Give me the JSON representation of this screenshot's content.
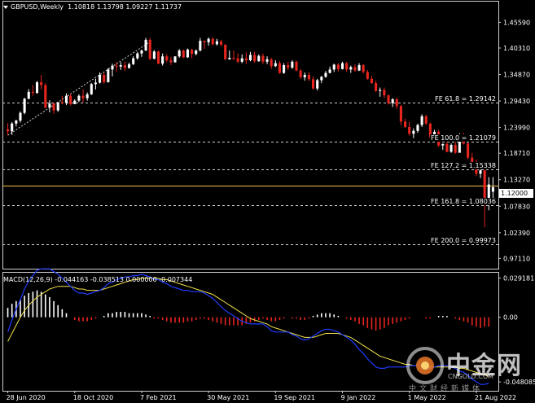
{
  "window": {
    "header": {
      "symbol": "GBPUSD,Weekly",
      "ohlc": "1.10818 1.13798 1.09227 1.11737"
    },
    "macd_header": "MACD(12,26,9) -0.044163 -0.038513 0.000000 -0.007344",
    "current_price": "1.12000",
    "colors": {
      "bull": "#ffffff",
      "bear": "#e8251e",
      "macd_signal": "#f2e24b",
      "macd_main": "#1f3cff",
      "current_line": "#f5c542",
      "grid": "#cfcfcf"
    }
  },
  "chart_data": [
    {
      "type": "candlestick",
      "title": "GBPUSD,Weekly",
      "ylim": [
        0.95,
        1.475
      ],
      "y_ticks": [
        "1.45590",
        "1.40310",
        "1.34870",
        "1.29430",
        "1.23990",
        "1.18710",
        "1.13270",
        "1.07830",
        "1.02390",
        "0.97110"
      ],
      "y_tick_values": [
        1.4559,
        1.4031,
        1.3487,
        1.2943,
        1.2399,
        1.1871,
        1.1327,
        1.0783,
        1.0239,
        0.9711
      ],
      "x_ticks": [
        "28 Jun 2020",
        "18 Oct 2020",
        "7 Feb 2021",
        "30 May 2021",
        "19 Sep 2021",
        "9 Jan 2022",
        "1 May 2022",
        "21 Aug 2022"
      ],
      "x_tick_index": [
        0,
        16,
        32,
        48,
        64,
        80,
        96,
        112
      ],
      "fib_levels": [
        {
          "label": "FE 61.8 = 1.29142",
          "value": 1.29142
        },
        {
          "label": "FE 100.0 = 1.21079",
          "value": 1.21079
        },
        {
          "label": "FE 127.2 = 1.15338",
          "value": 1.15338
        },
        {
          "label": "FE 161.8 = 1.08036",
          "value": 1.08036
        },
        {
          "label": "FE 200.0 = 0.99973",
          "value": 0.99973
        }
      ],
      "current_price": 1.12,
      "candles": [
        [
          1.236,
          1.249,
          1.224,
          1.232
        ],
        [
          1.232,
          1.251,
          1.225,
          1.248
        ],
        [
          1.248,
          1.256,
          1.242,
          1.254
        ],
        [
          1.254,
          1.273,
          1.25,
          1.27
        ],
        [
          1.27,
          1.301,
          1.267,
          1.299
        ],
        [
          1.299,
          1.319,
          1.298,
          1.313
        ],
        [
          1.313,
          1.327,
          1.305,
          1.311
        ],
        [
          1.311,
          1.335,
          1.309,
          1.333
        ],
        [
          1.333,
          1.348,
          1.318,
          1.327
        ],
        [
          1.327,
          1.331,
          1.279,
          1.281
        ],
        [
          1.281,
          1.296,
          1.271,
          1.289
        ],
        [
          1.289,
          1.291,
          1.268,
          1.275
        ],
        [
          1.275,
          1.292,
          1.272,
          1.292
        ],
        [
          1.292,
          1.305,
          1.288,
          1.29
        ],
        [
          1.29,
          1.31,
          1.286,
          1.305
        ],
        [
          1.305,
          1.309,
          1.285,
          1.288
        ],
        [
          1.288,
          1.298,
          1.288,
          1.295
        ],
        [
          1.295,
          1.308,
          1.292,
          1.305
        ],
        [
          1.305,
          1.318,
          1.291,
          1.3
        ],
        [
          1.3,
          1.312,
          1.295,
          1.308
        ],
        [
          1.308,
          1.331,
          1.307,
          1.329
        ],
        [
          1.329,
          1.34,
          1.318,
          1.332
        ],
        [
          1.332,
          1.353,
          1.33,
          1.348
        ],
        [
          1.348,
          1.353,
          1.33,
          1.333
        ],
        [
          1.333,
          1.362,
          1.332,
          1.359
        ],
        [
          1.359,
          1.371,
          1.345,
          1.367
        ],
        [
          1.367,
          1.374,
          1.354,
          1.365
        ],
        [
          1.365,
          1.374,
          1.358,
          1.368
        ],
        [
          1.368,
          1.375,
          1.356,
          1.362
        ],
        [
          1.362,
          1.373,
          1.361,
          1.37
        ],
        [
          1.37,
          1.386,
          1.368,
          1.382
        ],
        [
          1.382,
          1.395,
          1.379,
          1.392
        ],
        [
          1.392,
          1.4,
          1.385,
          1.398
        ],
        [
          1.398,
          1.424,
          1.397,
          1.42
        ],
        [
          1.42,
          1.424,
          1.378,
          1.381
        ],
        [
          1.381,
          1.399,
          1.38,
          1.396
        ],
        [
          1.396,
          1.398,
          1.37,
          1.371
        ],
        [
          1.371,
          1.392,
          1.367,
          1.386
        ],
        [
          1.386,
          1.39,
          1.374,
          1.378
        ],
        [
          1.378,
          1.385,
          1.368,
          1.374
        ],
        [
          1.374,
          1.386,
          1.373,
          1.386
        ],
        [
          1.386,
          1.401,
          1.383,
          1.398
        ],
        [
          1.398,
          1.4,
          1.382,
          1.384
        ],
        [
          1.384,
          1.402,
          1.383,
          1.4
        ],
        [
          1.4,
          1.401,
          1.382,
          1.391
        ],
        [
          1.391,
          1.4,
          1.388,
          1.398
        ],
        [
          1.398,
          1.424,
          1.396,
          1.418
        ],
        [
          1.418,
          1.418,
          1.401,
          1.415
        ],
        [
          1.415,
          1.425,
          1.408,
          1.422
        ],
        [
          1.422,
          1.425,
          1.409,
          1.411
        ],
        [
          1.411,
          1.422,
          1.408,
          1.417
        ],
        [
          1.417,
          1.42,
          1.407,
          1.41
        ],
        [
          1.41,
          1.411,
          1.379,
          1.38
        ],
        [
          1.38,
          1.398,
          1.379,
          1.383
        ],
        [
          1.383,
          1.398,
          1.378,
          1.382
        ],
        [
          1.382,
          1.392,
          1.372,
          1.375
        ],
        [
          1.375,
          1.39,
          1.372,
          1.382
        ],
        [
          1.382,
          1.394,
          1.37,
          1.378
        ],
        [
          1.378,
          1.395,
          1.376,
          1.389
        ],
        [
          1.389,
          1.396,
          1.373,
          1.376
        ],
        [
          1.376,
          1.39,
          1.375,
          1.387
        ],
        [
          1.387,
          1.392,
          1.37,
          1.375
        ],
        [
          1.375,
          1.386,
          1.37,
          1.38
        ],
        [
          1.38,
          1.383,
          1.36,
          1.366
        ],
        [
          1.366,
          1.378,
          1.364,
          1.372
        ],
        [
          1.372,
          1.376,
          1.35,
          1.352
        ],
        [
          1.352,
          1.372,
          1.35,
          1.368
        ],
        [
          1.368,
          1.375,
          1.358,
          1.363
        ],
        [
          1.363,
          1.378,
          1.36,
          1.375
        ],
        [
          1.375,
          1.377,
          1.355,
          1.357
        ],
        [
          1.357,
          1.36,
          1.34,
          1.343
        ],
        [
          1.343,
          1.353,
          1.336,
          1.348
        ],
        [
          1.348,
          1.354,
          1.335,
          1.339
        ],
        [
          1.339,
          1.345,
          1.318,
          1.32
        ],
        [
          1.32,
          1.34,
          1.316,
          1.337
        ],
        [
          1.337,
          1.346,
          1.331,
          1.344
        ],
        [
          1.344,
          1.356,
          1.342,
          1.352
        ],
        [
          1.352,
          1.365,
          1.351,
          1.359
        ],
        [
          1.359,
          1.371,
          1.354,
          1.369
        ],
        [
          1.369,
          1.372,
          1.355,
          1.36
        ],
        [
          1.36,
          1.375,
          1.359,
          1.372
        ],
        [
          1.372,
          1.375,
          1.354,
          1.359
        ],
        [
          1.359,
          1.367,
          1.352,
          1.364
        ],
        [
          1.364,
          1.37,
          1.354,
          1.357
        ],
        [
          1.357,
          1.372,
          1.356,
          1.368
        ],
        [
          1.368,
          1.37,
          1.351,
          1.354
        ],
        [
          1.354,
          1.358,
          1.338,
          1.34
        ],
        [
          1.34,
          1.346,
          1.33,
          1.331
        ],
        [
          1.331,
          1.336,
          1.313,
          1.315
        ],
        [
          1.315,
          1.322,
          1.303,
          1.317
        ],
        [
          1.317,
          1.322,
          1.3,
          1.306
        ],
        [
          1.306,
          1.308,
          1.287,
          1.29
        ],
        [
          1.29,
          1.3,
          1.282,
          1.298
        ],
        [
          1.298,
          1.301,
          1.278,
          1.284
        ],
        [
          1.284,
          1.286,
          1.245,
          1.252
        ],
        [
          1.252,
          1.258,
          1.239,
          1.241
        ],
        [
          1.241,
          1.251,
          1.223,
          1.227
        ],
        [
          1.227,
          1.238,
          1.218,
          1.233
        ],
        [
          1.233,
          1.248,
          1.229,
          1.245
        ],
        [
          1.245,
          1.267,
          1.241,
          1.263
        ],
        [
          1.263,
          1.266,
          1.245,
          1.248
        ],
        [
          1.248,
          1.25,
          1.215,
          1.22
        ],
        [
          1.22,
          1.235,
          1.215,
          1.231
        ],
        [
          1.231,
          1.235,
          1.2,
          1.203
        ],
        [
          1.203,
          1.207,
          1.194,
          1.206
        ],
        [
          1.206,
          1.212,
          1.189,
          1.19
        ],
        [
          1.19,
          1.207,
          1.188,
          1.204
        ],
        [
          1.204,
          1.21,
          1.186,
          1.188
        ],
        [
          1.188,
          1.228,
          1.189,
          1.216
        ],
        [
          1.216,
          1.229,
          1.205,
          1.207
        ],
        [
          1.207,
          1.209,
          1.175,
          1.178
        ],
        [
          1.178,
          1.188,
          1.165,
          1.168
        ],
        [
          1.168,
          1.174,
          1.14,
          1.145
        ],
        [
          1.145,
          1.16,
          1.136,
          1.152
        ],
        [
          1.152,
          1.153,
          1.035,
          1.085
        ],
        [
          1.085,
          1.138,
          1.07,
          1.123
        ],
        [
          1.108,
          1.138,
          1.0923,
          1.1174
        ]
      ]
    },
    {
      "type": "histogram+line",
      "title": "MACD(12,26,9) -0.044163 -0.038513 0.000000 -0.007344",
      "ylim": [
        -0.0535,
        0.0325
      ],
      "y_ticks": [
        "0.029181",
        "0.00",
        "-0.048085"
      ],
      "y_tick_values": [
        0.029181,
        0.0,
        -0.048085
      ],
      "histogram": [
        0.007,
        0.01,
        0.012,
        0.013,
        0.016,
        0.018,
        0.019,
        0.02,
        0.019,
        0.017,
        0.015,
        0.012,
        0.009,
        0.006,
        0.003,
        0.0,
        -0.002,
        -0.003,
        -0.003,
        -0.003,
        -0.002,
        -0.001,
        0.0,
        0.001,
        0.003,
        0.003,
        0.004,
        0.004,
        0.004,
        0.003,
        0.003,
        0.003,
        0.003,
        0.002,
        0.001,
        -0.001,
        -0.001,
        -0.002,
        -0.003,
        -0.004,
        -0.004,
        -0.004,
        -0.004,
        -0.003,
        -0.003,
        -0.002,
        -0.001,
        -0.001,
        -0.002,
        -0.003,
        -0.004,
        -0.005,
        -0.006,
        -0.006,
        -0.006,
        -0.006,
        -0.006,
        -0.005,
        -0.004,
        -0.003,
        -0.002,
        -0.001,
        -0.002,
        -0.003,
        -0.003,
        -0.002,
        -0.001,
        0.0,
        -0.001,
        -0.001,
        -0.002,
        -0.002,
        -0.001,
        0.001,
        0.002,
        0.003,
        0.003,
        0.003,
        0.002,
        0.001,
        0.0,
        -0.001,
        -0.002,
        -0.003,
        -0.005,
        -0.006,
        -0.008,
        -0.009,
        -0.01,
        -0.009,
        -0.008,
        -0.006,
        -0.005,
        -0.004,
        -0.003,
        -0.002,
        -0.001,
        0.0,
        0.0,
        0.0,
        -0.001,
        -0.001,
        0.0,
        0.001,
        0.001,
        0.001,
        0.0,
        -0.001,
        -0.002,
        -0.003,
        -0.004,
        -0.006,
        -0.007,
        -0.008,
        -0.007,
        -0.007
      ],
      "signal": [
        -0.018,
        -0.012,
        -0.006,
        0.0,
        0.005,
        0.009,
        0.012,
        0.015,
        0.017,
        0.019,
        0.021,
        0.022,
        0.023,
        0.023,
        0.023,
        0.023,
        0.022,
        0.021,
        0.021,
        0.02,
        0.02,
        0.02,
        0.02,
        0.021,
        0.022,
        0.023,
        0.024,
        0.025,
        0.026,
        0.027,
        0.028,
        0.028,
        0.029,
        0.029,
        0.029,
        0.029,
        0.029,
        0.028,
        0.028,
        0.027,
        0.026,
        0.025,
        0.024,
        0.023,
        0.022,
        0.021,
        0.02,
        0.019,
        0.018,
        0.017,
        0.015,
        0.013,
        0.011,
        0.009,
        0.007,
        0.005,
        0.003,
        0.001,
        -0.001,
        -0.002,
        -0.003,
        -0.004,
        -0.005,
        -0.007,
        -0.008,
        -0.009,
        -0.01,
        -0.011,
        -0.012,
        -0.013,
        -0.014,
        -0.015,
        -0.015,
        -0.015,
        -0.014,
        -0.013,
        -0.012,
        -0.012,
        -0.012,
        -0.012,
        -0.013,
        -0.014,
        -0.015,
        -0.017,
        -0.019,
        -0.021,
        -0.023,
        -0.025,
        -0.027,
        -0.029,
        -0.03,
        -0.031,
        -0.032,
        -0.033,
        -0.034,
        -0.035,
        -0.035,
        -0.036,
        -0.036,
        -0.036,
        -0.037,
        -0.037,
        -0.037,
        -0.037,
        -0.037,
        -0.037,
        -0.037,
        -0.037,
        -0.038,
        -0.038,
        -0.039,
        -0.04,
        -0.041,
        -0.042,
        -0.043,
        -0.044
      ],
      "main": [
        -0.011,
        -0.002,
        0.006,
        0.013,
        0.021,
        0.027,
        0.031,
        0.035,
        0.036,
        0.036,
        0.036,
        0.034,
        0.032,
        0.029,
        0.026,
        0.023,
        0.02,
        0.018,
        0.018,
        0.017,
        0.018,
        0.019,
        0.02,
        0.022,
        0.025,
        0.026,
        0.028,
        0.029,
        0.03,
        0.03,
        0.031,
        0.031,
        0.032,
        0.031,
        0.03,
        0.028,
        0.028,
        0.026,
        0.025,
        0.023,
        0.022,
        0.021,
        0.02,
        0.02,
        0.019,
        0.019,
        0.019,
        0.018,
        0.016,
        0.014,
        0.011,
        0.008,
        0.005,
        0.003,
        0.001,
        -0.001,
        -0.003,
        -0.004,
        -0.005,
        -0.005,
        -0.005,
        -0.005,
        -0.007,
        -0.01,
        -0.011,
        -0.011,
        -0.011,
        -0.011,
        -0.013,
        -0.014,
        -0.016,
        -0.017,
        -0.016,
        -0.014,
        -0.012,
        -0.01,
        -0.009,
        -0.009,
        -0.01,
        -0.011,
        -0.013,
        -0.015,
        -0.017,
        -0.02,
        -0.024,
        -0.027,
        -0.031,
        -0.034,
        -0.037,
        -0.038,
        -0.038,
        -0.037,
        -0.037,
        -0.037,
        -0.037,
        -0.037,
        -0.036,
        -0.036,
        -0.036,
        -0.036,
        -0.038,
        -0.038,
        -0.037,
        -0.036,
        -0.036,
        -0.036,
        -0.037,
        -0.038,
        -0.04,
        -0.041,
        -0.043,
        -0.046,
        -0.048,
        -0.05,
        -0.05,
        -0.049
      ]
    }
  ],
  "watermark": {
    "brand": "中金网",
    "domain": "CNGOLD.COM",
    "tagline": "中文财经新媒体"
  }
}
